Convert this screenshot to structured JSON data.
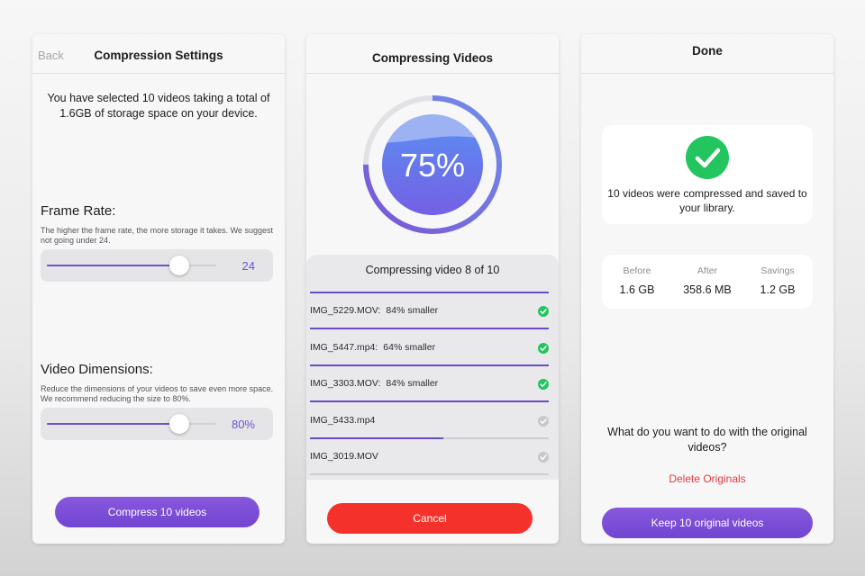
{
  "settings_screen": {
    "back_label": "Back",
    "title": "Compression Settings",
    "intro": "You have selected 10 videos taking a total of 1.6GB of storage space on your device.",
    "frame_rate": {
      "title": "Frame Rate:",
      "description": "The higher the frame rate, the more storage it takes. We suggest not going under 24.",
      "value": "24",
      "slider_fraction": 0.78
    },
    "video_dimensions": {
      "title": "Video Dimensions:",
      "description": "Reduce the dimensions of your videos to save even more space. We recommend reducing the size to 80%.",
      "value": "80%",
      "slider_fraction": 0.78
    },
    "compress_button": "Compress 10 videos"
  },
  "progress_screen": {
    "title": "Compressing Videos",
    "percent": 75,
    "percent_label": "75%",
    "status": "Compressing video 8 of 10",
    "cancel_button": "Cancel",
    "files": [
      {
        "name": "IMG_5229.MOV",
        "result": "84% smaller",
        "done": true,
        "progress": 1.0
      },
      {
        "name": "IMG_5447.mp4",
        "result": "64% smaller",
        "done": true,
        "progress": 1.0
      },
      {
        "name": "IMG_3303.MOV",
        "result": "84% smaller",
        "done": true,
        "progress": 1.0
      },
      {
        "name": "IMG_5433.mp4",
        "result": "",
        "done": false,
        "progress": 0.56
      },
      {
        "name": "IMG_3019.MOV",
        "result": "",
        "done": false,
        "progress": 0.0
      }
    ]
  },
  "done_screen": {
    "title": "Done",
    "message": "10 videos were compressed and saved to your library.",
    "stats": [
      {
        "label": "Before",
        "value": "1.6 GB"
      },
      {
        "label": "After",
        "value": "358.6 MB"
      },
      {
        "label": "Savings",
        "value": "1.2 GB"
      }
    ],
    "question": "What do you want to do with the original videos?",
    "delete_link": "Delete Originals",
    "keep_button": "Keep 10 original videos"
  },
  "colors": {
    "accent_purple": "#6f52cc",
    "success_green": "#22c55e",
    "danger_red": "#f5312b",
    "inactive_gray": "#c7c7cc"
  }
}
